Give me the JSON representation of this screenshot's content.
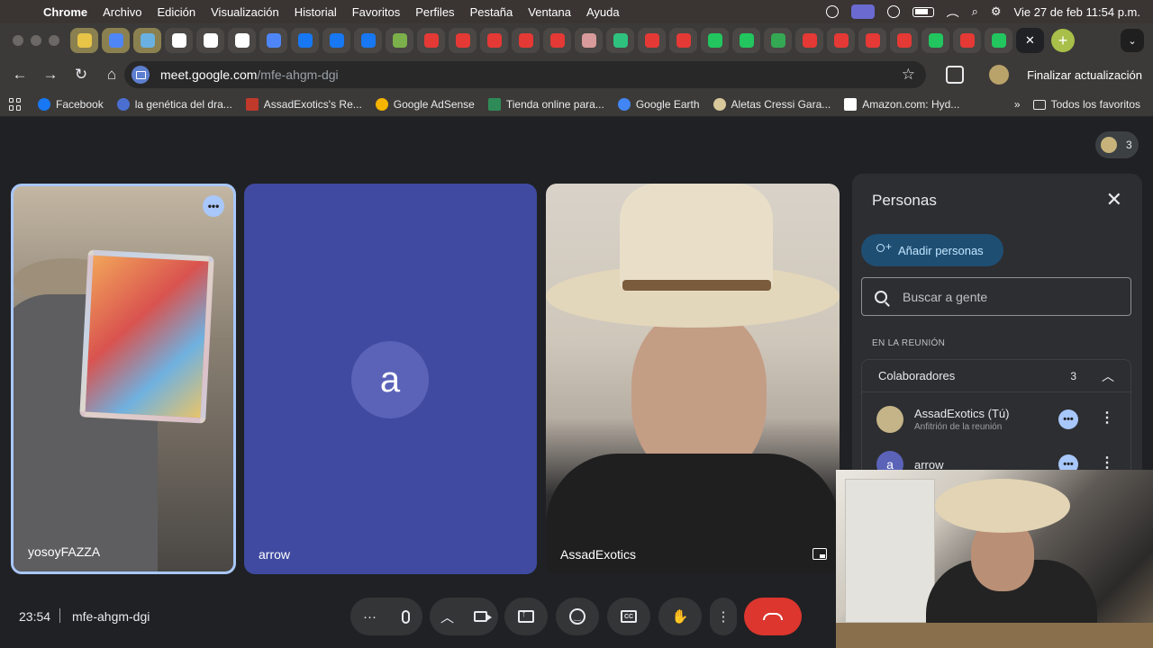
{
  "menubar": {
    "app": "Chrome",
    "items": [
      "Archivo",
      "Edición",
      "Visualización",
      "Historial",
      "Favoritos",
      "Perfiles",
      "Pestaña",
      "Ventana",
      "Ayuda"
    ],
    "clock": "Vie 27 de feb  11:54 p.m."
  },
  "tabs": {
    "count_shown": 30,
    "active_close": "✕",
    "new_tab": "+"
  },
  "toolbar": {
    "url_host": "meet.google.com",
    "url_path": "/mfe-ahgm-dgi",
    "update_label": "Finalizar actualización"
  },
  "bookmarks": {
    "items": [
      {
        "label": "Facebook",
        "icon": "facebook-icon",
        "color": "#1877f2"
      },
      {
        "label": "la genética del dra...",
        "icon": "w-icon",
        "color": "#4a6fd1"
      },
      {
        "label": "AssadExotics's Re...",
        "icon": "chart-icon",
        "color": "#c0392b"
      },
      {
        "label": "Google AdSense",
        "icon": "adsense-icon",
        "color": "#f4b400"
      },
      {
        "label": "Tienda online para...",
        "icon": "store-icon",
        "color": "#2e8b57"
      },
      {
        "label": "Google Earth",
        "icon": "earth-icon",
        "color": "#4285f4"
      },
      {
        "label": "Aletas Cressi Gara...",
        "icon": "cressi-icon",
        "color": "#d8c89a"
      },
      {
        "label": "Amazon.com: Hyd...",
        "icon": "amazon-icon",
        "color": "#ffffff"
      }
    ],
    "overflow": "»",
    "all_label": "Todos los favoritos"
  },
  "meet": {
    "participant_count": "3",
    "tiles": [
      {
        "name": "yosoyFAZZA"
      },
      {
        "name": "arrow",
        "avatar_letter": "a"
      },
      {
        "name": "AssadExotics"
      }
    ],
    "meeting_time": "23:54",
    "meeting_code": "mfe-ahgm-dgi"
  },
  "panel": {
    "title": "Personas",
    "add_label": "Añadir personas",
    "search_placeholder": "Buscar a gente",
    "section_label": "EN LA REUNIÓN",
    "group_label": "Colaboradores",
    "group_count": "3",
    "members": [
      {
        "name": "AssadExotics (Tú)",
        "subtitle": "Anfitrión de la reunión"
      },
      {
        "name": "arrow",
        "avatar_letter": "a"
      }
    ]
  },
  "colors": {
    "accent_blue": "#a8c7fa",
    "end_call_red": "#dc362e",
    "arrow_tile": "#3f4aa0"
  }
}
